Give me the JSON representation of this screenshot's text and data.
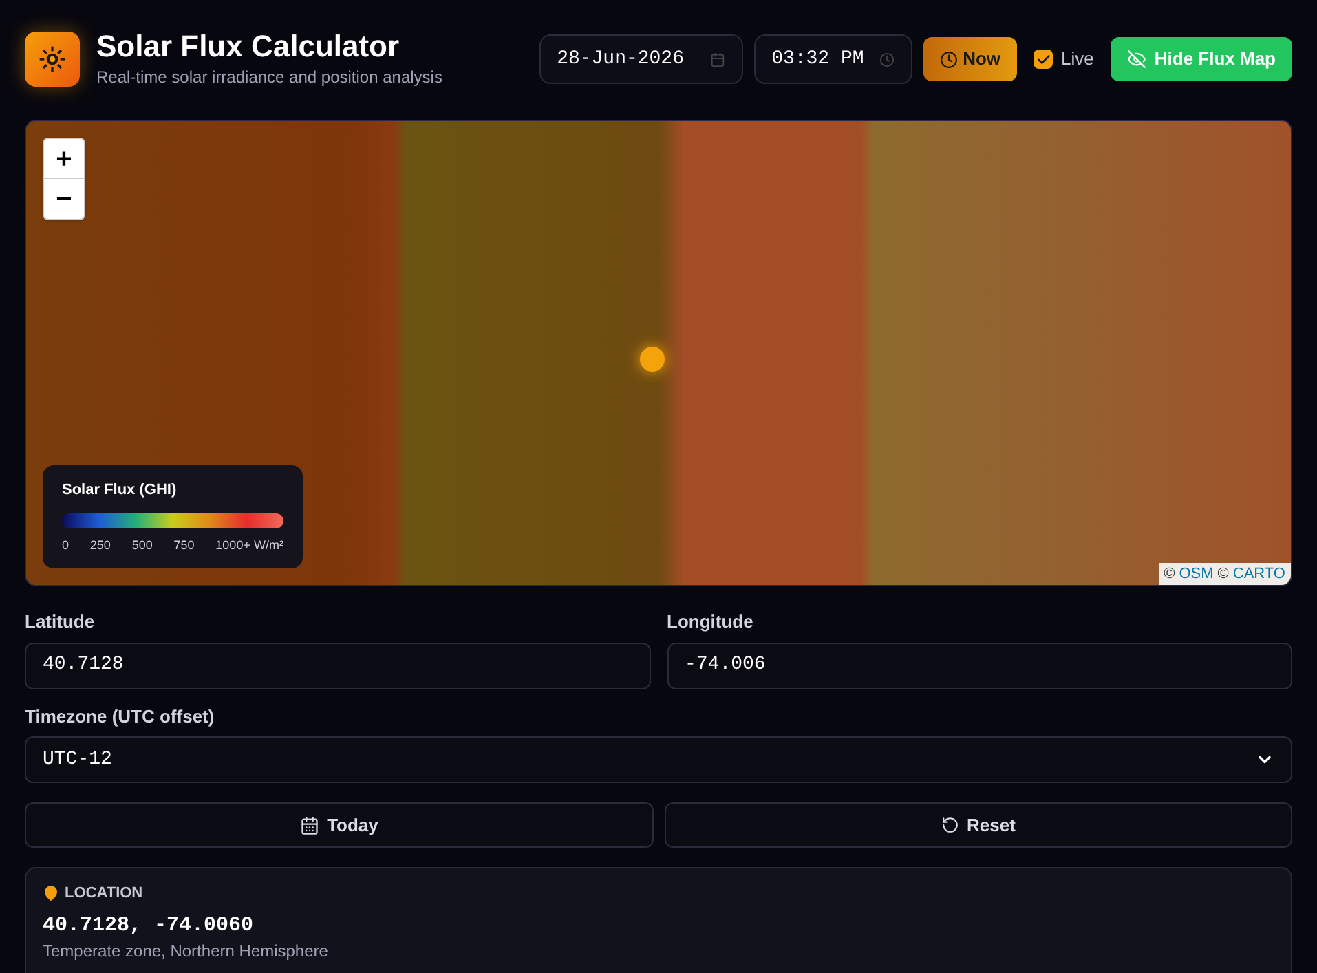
{
  "header": {
    "title": "Solar Flux Calculator",
    "subtitle": "Real-time solar irradiance and position analysis"
  },
  "toolbar": {
    "date": "28-Jun-2026",
    "time": "03:32 PM",
    "now_button": "Now",
    "live": {
      "label": "Live",
      "checked": true
    },
    "flux_map_button": "Hide Flux Map"
  },
  "map": {
    "zoom_in": "+",
    "zoom_out": "−",
    "legend": {
      "title": "Solar Flux (GHI)",
      "ticks": [
        "0",
        "250",
        "500",
        "750",
        "1000+ W/m²"
      ]
    },
    "attribution": {
      "prefix": "©",
      "osm": "OSM",
      "carto": "CARTO"
    }
  },
  "form": {
    "latitude": {
      "label": "Latitude",
      "value": "40.7128"
    },
    "longitude": {
      "label": "Longitude",
      "value": "-74.006"
    },
    "timezone": {
      "label": "Timezone (UTC offset)",
      "value": "UTC-12"
    },
    "buttons": [
      {
        "kind": "today",
        "label": "Today"
      },
      {
        "kind": "reset",
        "label": "Reset"
      }
    ]
  },
  "location_card": {
    "heading": "LOCATION",
    "coordinates": "40.7128, -74.0060",
    "description": "Temperate zone, Northern Hemisphere"
  }
}
